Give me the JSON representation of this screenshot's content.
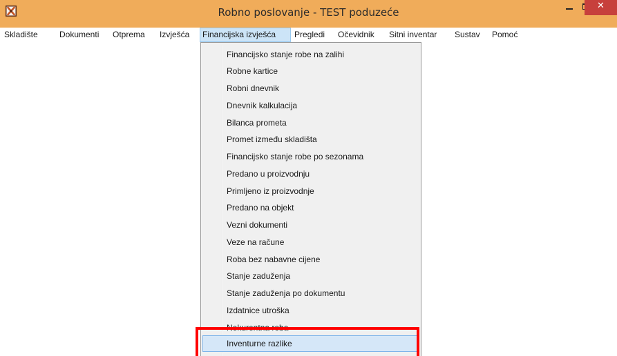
{
  "window": {
    "title": "Robno poslovanje  - TEST poduzeće",
    "minimize_symbol": "",
    "maximize_symbol": "",
    "close_symbol": "✕",
    "app_icon": "app-logo-icon"
  },
  "menubar": {
    "items": [
      {
        "label": "Skladište"
      },
      {
        "label": "Dokumenti"
      },
      {
        "label": "Otprema"
      },
      {
        "label": "Izvješća"
      },
      {
        "label": "Financijska izvješća"
      },
      {
        "label": "Pregledi"
      },
      {
        "label": "Očevidnik"
      },
      {
        "label": "Sitni inventar"
      },
      {
        "label": "Sustav"
      },
      {
        "label": "Pomoć"
      }
    ],
    "active_item": "Financijska izvješća"
  },
  "dropdown": {
    "items": [
      {
        "label": "Financijsko stanje robe na zalihi"
      },
      {
        "label": "Robne kartice"
      },
      {
        "label": "Robni dnevnik"
      },
      {
        "label": "Dnevnik kalkulacija"
      },
      {
        "label": "Bilanca prometa"
      },
      {
        "label": "Promet između skladišta"
      },
      {
        "label": "Financijsko stanje robe po sezonama"
      },
      {
        "label": "Predano u proizvodnju"
      },
      {
        "label": "Primljeno iz proizvodnje"
      },
      {
        "label": "Predano na objekt"
      },
      {
        "label": "Vezni dokumenti"
      },
      {
        "label": "Veze na račune"
      },
      {
        "label": "Roba bez nabavne cijene"
      },
      {
        "label": "Stanje zaduženja"
      },
      {
        "label": "Stanje zaduženja po dokumentu"
      },
      {
        "label": "Izdatnice utroška"
      },
      {
        "label": "Nekurentna roba"
      },
      {
        "label": "Inventurne razlike"
      }
    ],
    "highlighted_item": "Inventurne razlike"
  },
  "colors": {
    "titlebar": "#f0ac5a",
    "close_button": "#c7403c",
    "menu_active": "#cce4f7",
    "item_highlight": "#d5e7f8",
    "annotation_box": "#ff0000"
  }
}
